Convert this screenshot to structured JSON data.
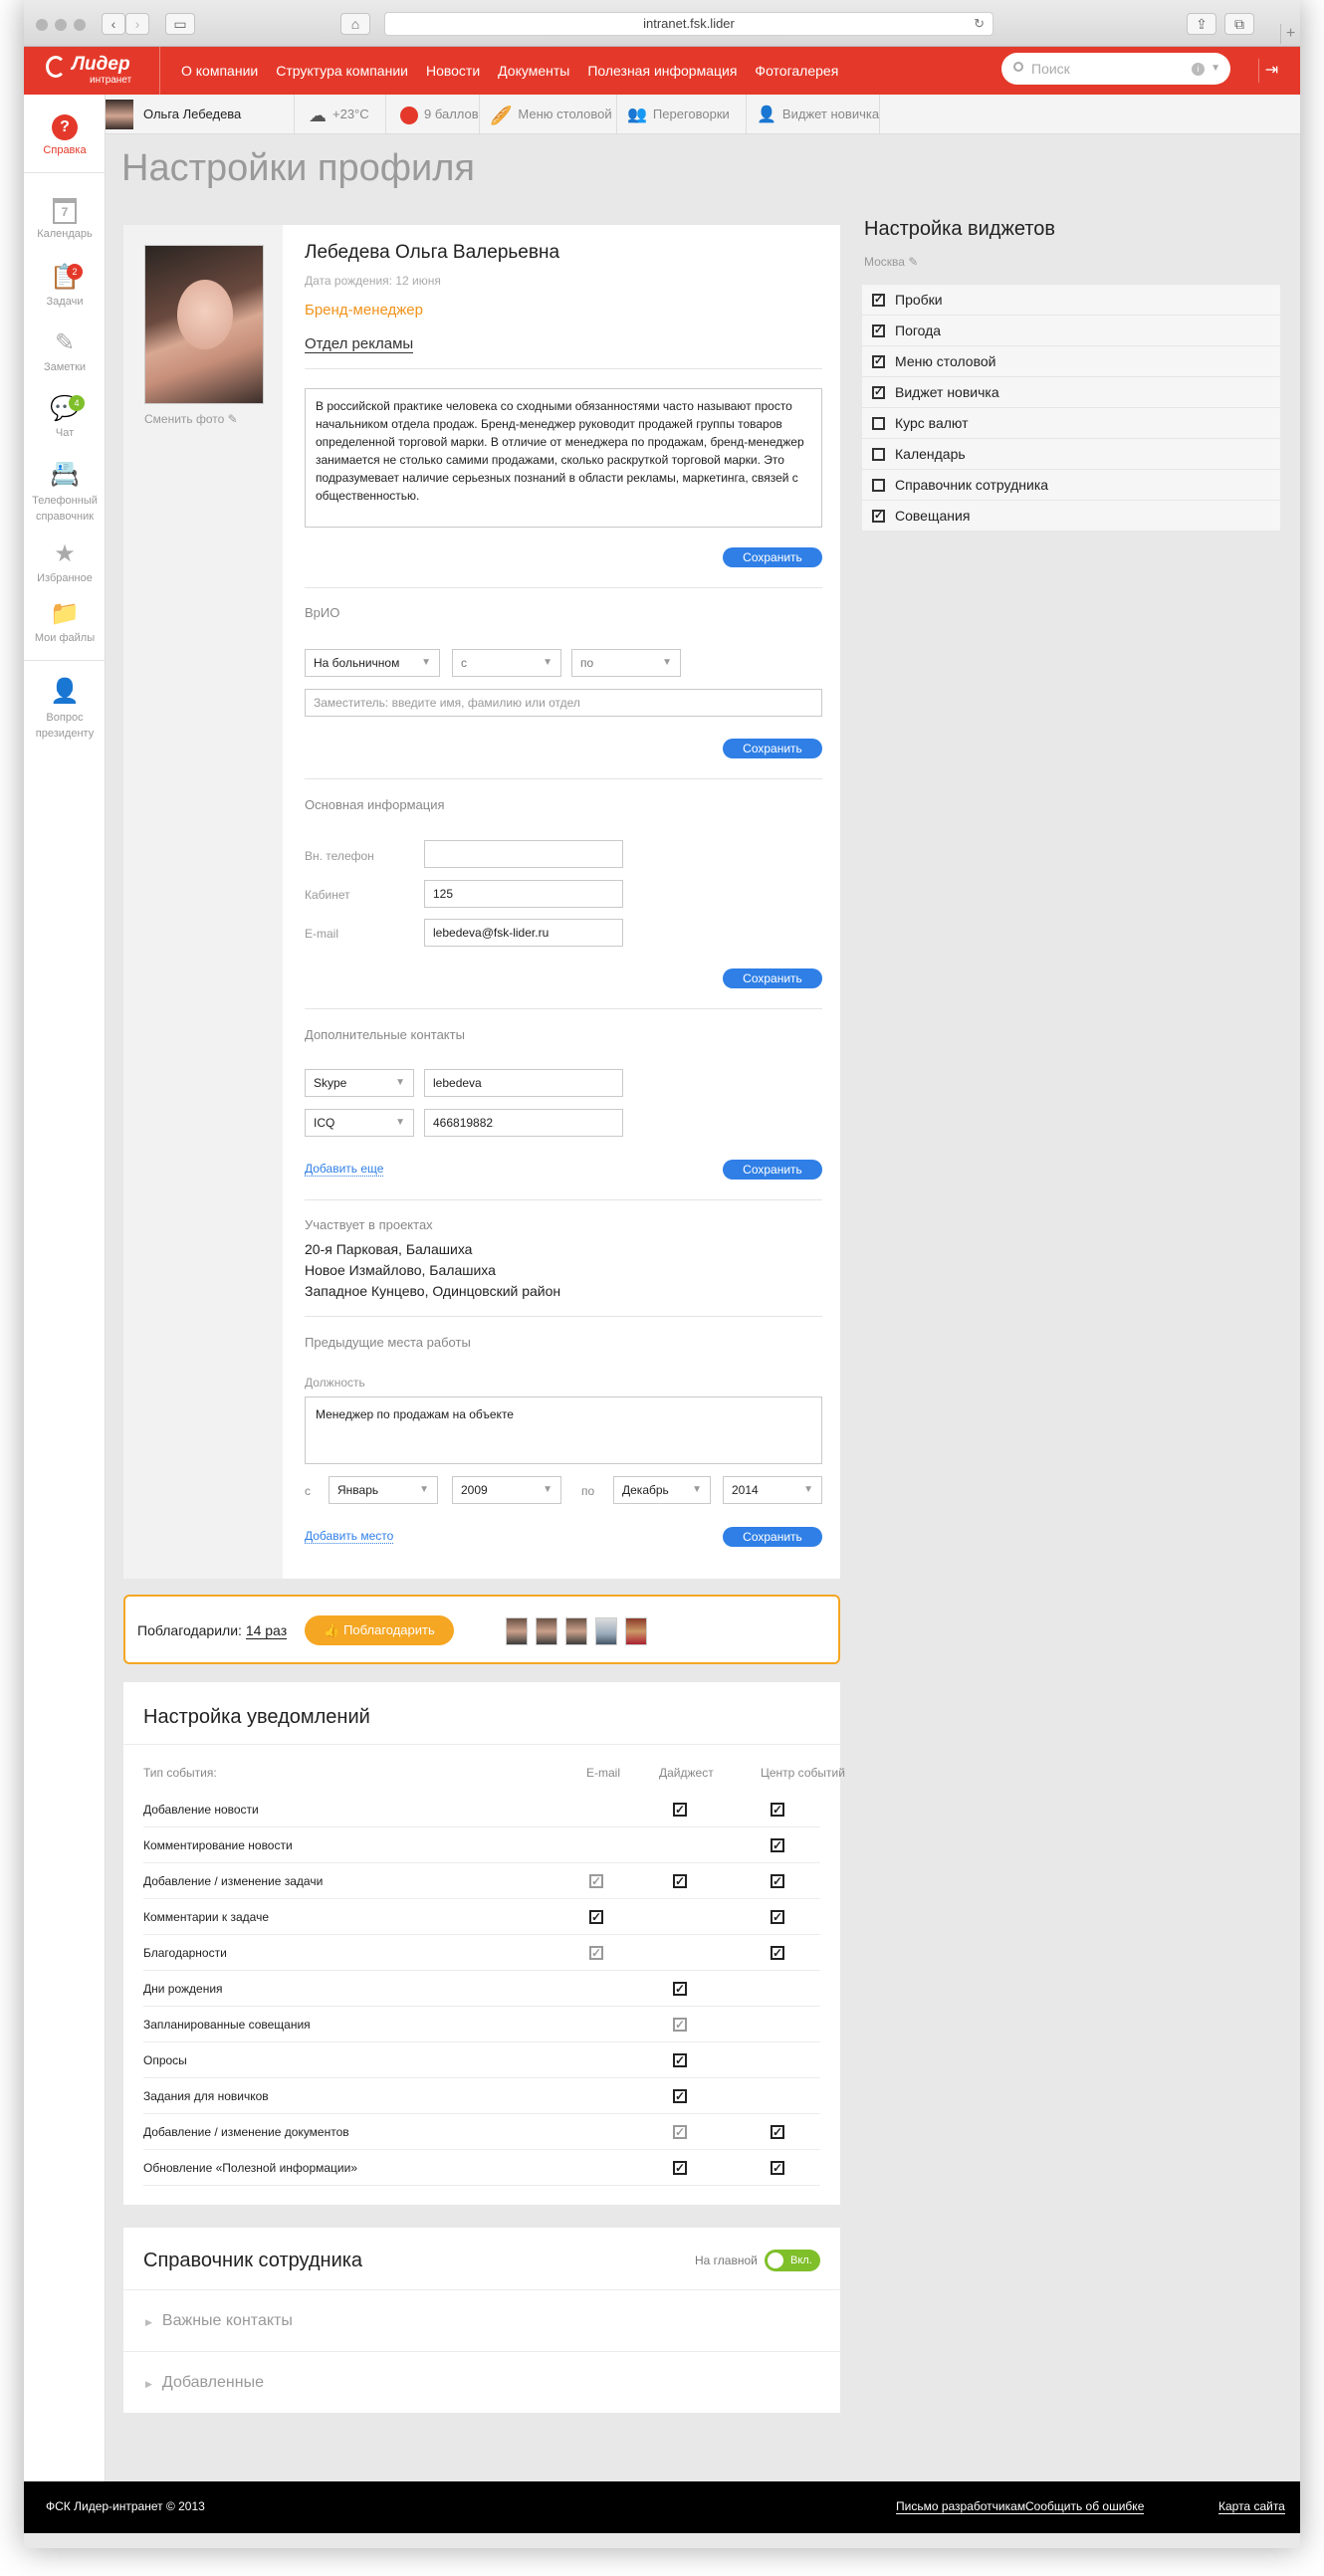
{
  "browser": {
    "url": "intranet.fsk.lider"
  },
  "brand": {
    "name": "Лидер",
    "sub": "интранет",
    "accent": "#e4392a"
  },
  "nav": [
    "О компании",
    "Структура компании",
    "Новости",
    "Документы",
    "Полезная информация",
    "Фотогалерея"
  ],
  "search": {
    "placeholder": "Поиск"
  },
  "status": {
    "user": "Ольга Лебедева",
    "weather": "+23°C",
    "points": "9 баллов",
    "menu": "Меню столовой",
    "meetings": "Переговорки",
    "newbie": "Виджет новичка"
  },
  "sidebar": [
    {
      "label": "Справка",
      "icon": "help-icon"
    },
    {
      "label": "Календарь",
      "icon": "calendar-icon",
      "badge": "7"
    },
    {
      "label": "Задачи",
      "icon": "tasks-icon",
      "badge": "2"
    },
    {
      "label": "Заметки",
      "icon": "pencil-icon"
    },
    {
      "label": "Чат",
      "icon": "chat-icon",
      "badge": "4"
    },
    {
      "label": "Телефонный справочник",
      "icon": "phonebook-icon"
    },
    {
      "label": "Избранное",
      "icon": "star-icon"
    },
    {
      "label": "Мои файлы",
      "icon": "folder-icon"
    },
    {
      "label": "Вопрос президенту",
      "icon": "person-icon"
    }
  ],
  "page": {
    "title": "Настройки профиля"
  },
  "profile": {
    "change_photo": "Сменить фото",
    "name": "Лебедева Ольга Валерьевна",
    "dob": "Дата рождения: 12 июня",
    "position": "Бренд-менеджер",
    "department": "Отдел рекламы",
    "about": "В российской практике человека со сходными обязанностями часто называют просто начальником отдела продаж. Бренд-менеджер руководит продажей группы товаров определенной торговой марки. В отличие от менеджера по продажам, бренд-менеджер занимается не столько самими продажами, сколько раскруткой торговой марки. Это подразумевает наличие серьезных познаний в области рекламы, маркетинга, связей с общественностью.",
    "save": "Сохранить"
  },
  "vrio": {
    "title": "ВрИО",
    "reason": "На больничном",
    "from": "с",
    "to": "по",
    "deputy_placeholder": "Заместитель: введите имя, фамилию или отдел"
  },
  "basic": {
    "title": "Основная информация",
    "phone_label": "Вн. телефон",
    "phone": "",
    "office_label": "Кабинет",
    "office": "125",
    "email_label": "E-mail",
    "email": "lebedeva@fsk-lider.ru"
  },
  "extra": {
    "title": "Дополнительные контакты",
    "contacts": [
      {
        "type": "Skype",
        "value": "lebedeva"
      },
      {
        "type": "ICQ",
        "value": "466819882"
      }
    ],
    "add": "Добавить еще"
  },
  "projects": {
    "title": "Участвует в проектах",
    "items": [
      "20-я Парковая, Балашиха",
      "Новое Измайлово, Балашиха",
      "Западное Кунцево, Одинцовский район"
    ]
  },
  "prevjobs": {
    "title": "Предыдущие места работы",
    "role_label": "Должность",
    "role": "Менеджер по продажам на объекте",
    "from_label": "с",
    "from_month": "Январь",
    "from_year": "2009",
    "to_label": "по",
    "to_month": "Декабрь",
    "to_year": "2014",
    "add": "Добавить место"
  },
  "widgets": {
    "title": "Настройка виджетов",
    "city": "Москва",
    "items": [
      {
        "label": "Пробки",
        "on": true
      },
      {
        "label": "Погода",
        "on": true
      },
      {
        "label": "Меню столовой",
        "on": true
      },
      {
        "label": "Виджет новичка",
        "on": true
      },
      {
        "label": "Курс валют",
        "on": false
      },
      {
        "label": "Календарь",
        "on": false
      },
      {
        "label": "Справочник сотрудника",
        "on": false
      },
      {
        "label": "Совещания",
        "on": true
      }
    ]
  },
  "thanks": {
    "label": "Поблагодарили:",
    "count": "14 раз",
    "button": "Поблагодарить"
  },
  "notifications": {
    "title": "Настройка уведомлений",
    "cols": [
      "Тип события:",
      "E-mail",
      "Дайджест",
      "Центр событий"
    ],
    "rows": [
      {
        "label": "Добавление новости",
        "email": "",
        "digest": "on",
        "center": "on"
      },
      {
        "label": "Комментирование новости",
        "email": "",
        "digest": "",
        "center": "on"
      },
      {
        "label": "Добавление / изменение задачи",
        "email": "grey",
        "digest": "on",
        "center": "on"
      },
      {
        "label": "Комментарии к задаче",
        "email": "on",
        "digest": "",
        "center": "on"
      },
      {
        "label": "Благодарности",
        "email": "grey",
        "digest": "",
        "center": "on"
      },
      {
        "label": "Дни рождения",
        "email": "",
        "digest": "on",
        "center": ""
      },
      {
        "label": "Запланированные совещания",
        "email": "",
        "digest": "grey",
        "center": ""
      },
      {
        "label": "Опросы",
        "email": "",
        "digest": "on",
        "center": ""
      },
      {
        "label": "Задания для новичков",
        "email": "",
        "digest": "on",
        "center": ""
      },
      {
        "label": "Добавление / изменение документов",
        "email": "",
        "digest": "grey",
        "center": "on"
      },
      {
        "label": "Обновление «Полезной информации»",
        "email": "",
        "digest": "on",
        "center": "on"
      }
    ]
  },
  "directory": {
    "title": "Справочник сотрудника",
    "on_main": "На главной",
    "toggle": "Вкл.",
    "sections": [
      "Важные контакты",
      "Добавленные"
    ]
  },
  "footer": {
    "copyright": "ФСК Лидер-интранет © 2013",
    "links": [
      "Письмо разработчикам",
      "Сообщить об ошибке",
      "Карта сайта"
    ]
  }
}
